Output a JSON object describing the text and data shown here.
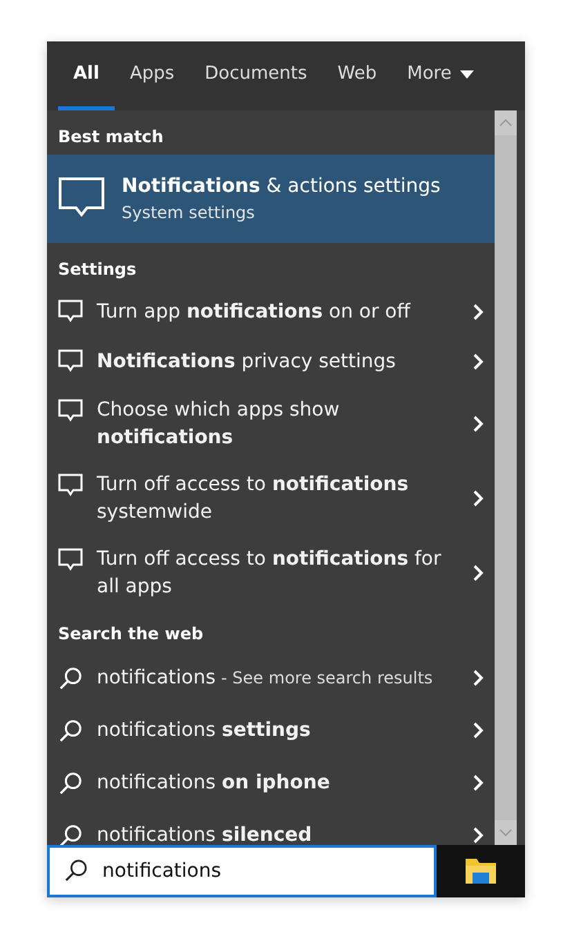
{
  "tabs": [
    {
      "label": "All",
      "selected": true
    },
    {
      "label": "Apps",
      "selected": false
    },
    {
      "label": "Documents",
      "selected": false
    },
    {
      "label": "Web",
      "selected": false
    },
    {
      "label": "More",
      "selected": false,
      "dropdown": true
    }
  ],
  "best_match": {
    "heading": "Best match",
    "title": "**Notifications** & actions settings",
    "subtitle": "System settings"
  },
  "settings": {
    "heading": "Settings",
    "items": [
      {
        "text": "Turn app **notifications** on or off"
      },
      {
        "text": "**Notifications** privacy settings"
      },
      {
        "text": "Choose which apps show **notifications**"
      },
      {
        "text": "Turn off access to **notifications** systemwide"
      },
      {
        "text": "Turn off access to **notifications** for all apps"
      }
    ]
  },
  "web": {
    "heading": "Search the web",
    "items": [
      {
        "text": "notifications",
        "suffix": "- See more search results"
      },
      {
        "text": "notifications **settings**"
      },
      {
        "text": "notifications **on iphone**"
      },
      {
        "text": "notifications **silenced**"
      }
    ]
  },
  "search": {
    "value": "notifications"
  }
}
